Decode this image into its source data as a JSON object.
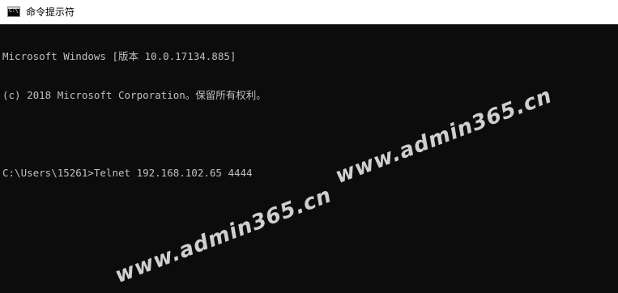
{
  "window": {
    "title": "命令提示符",
    "icon": "cmd-icon",
    "icon_text": "C:\\"
  },
  "console": {
    "lines": [
      "Microsoft Windows [版本 10.0.17134.885]",
      "(c) 2018 Microsoft Corporation。保留所有权利。",
      "",
      "C:\\Users\\15261>Telnet 192.168.102.65 4444"
    ],
    "background": "#0c0c0c",
    "foreground": "#c0c0c0"
  },
  "watermarks": [
    "www.admin365.cn",
    "www.admin365.cn"
  ]
}
